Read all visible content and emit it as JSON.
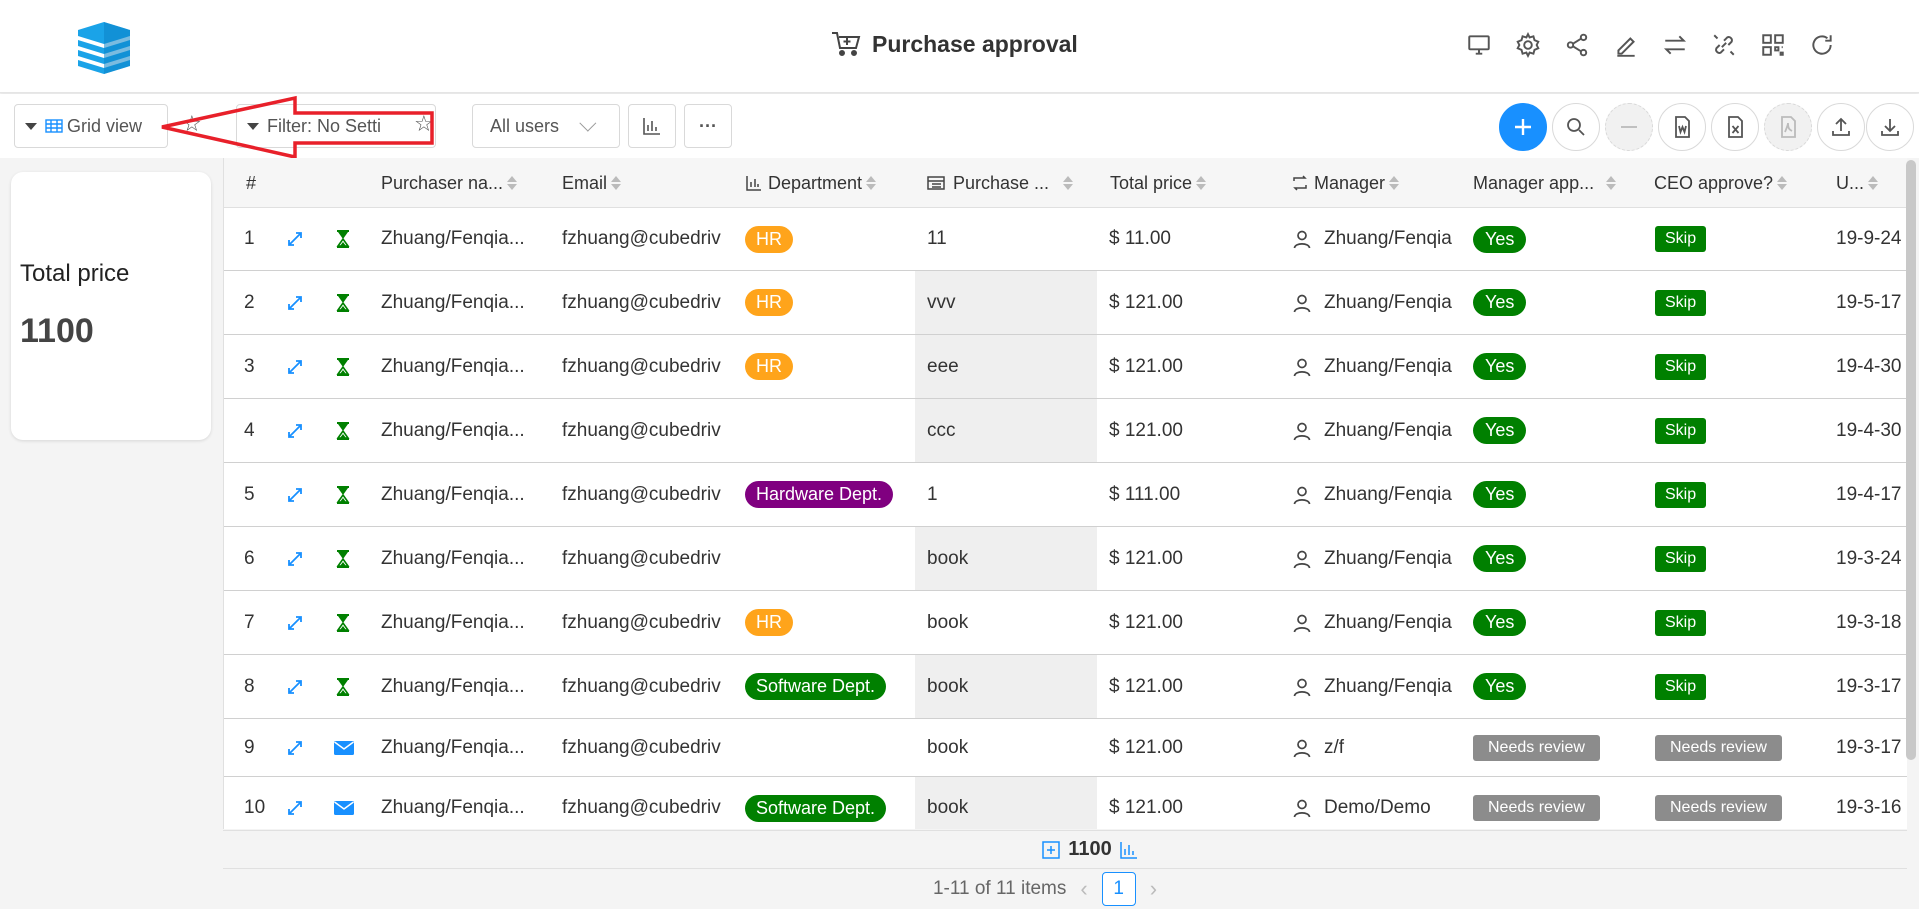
{
  "header": {
    "title": "Purchase approval",
    "icons": [
      "desktop-icon",
      "gear-icon",
      "share-icon",
      "edit-icon",
      "switch-icon",
      "link-icon",
      "qrcode-icon",
      "refresh-icon"
    ]
  },
  "toolbar": {
    "view_label": "Grid view",
    "filter_label": "Filter: No Setti",
    "users_select": "All users",
    "more_label": "···"
  },
  "summary_card": {
    "label": "Total price",
    "value": "1100"
  },
  "grid": {
    "columns": [
      {
        "key": "num",
        "label": "#"
      },
      {
        "key": "purchaser",
        "label": "Purchaser na..."
      },
      {
        "key": "email",
        "label": "Email"
      },
      {
        "key": "department",
        "label": "Department"
      },
      {
        "key": "purchase",
        "label": "Purchase ..."
      },
      {
        "key": "total",
        "label": "Total price"
      },
      {
        "key": "manager",
        "label": "Manager"
      },
      {
        "key": "manager_approve",
        "label": "Manager app..."
      },
      {
        "key": "ceo_approve",
        "label": "CEO approve?"
      },
      {
        "key": "updated",
        "label": "U..."
      }
    ],
    "rows": [
      {
        "num": "1",
        "status": "hourglass",
        "purchaser": "Zhuang/Fenqia...",
        "email": "fzhuang@cubedriv",
        "department": "HR",
        "dept_color": "orange",
        "purchase": "11",
        "total": "$ 11.00",
        "manager": "Zhuang/Fenqia",
        "manager_approve": "Yes",
        "ceo_approve": "Skip",
        "updated": "19-9-24"
      },
      {
        "num": "2",
        "status": "hourglass",
        "purchaser": "Zhuang/Fenqia...",
        "email": "fzhuang@cubedriv",
        "department": "HR",
        "dept_color": "orange",
        "purchase": "vvv",
        "total": "$ 121.00",
        "manager": "Zhuang/Fenqia",
        "manager_approve": "Yes",
        "ceo_approve": "Skip",
        "updated": "19-5-17"
      },
      {
        "num": "3",
        "status": "hourglass",
        "purchaser": "Zhuang/Fenqia...",
        "email": "fzhuang@cubedriv",
        "department": "HR",
        "dept_color": "orange",
        "purchase": "eee",
        "total": "$ 121.00",
        "manager": "Zhuang/Fenqia",
        "manager_approve": "Yes",
        "ceo_approve": "Skip",
        "updated": "19-4-30"
      },
      {
        "num": "4",
        "status": "hourglass",
        "purchaser": "Zhuang/Fenqia...",
        "email": "fzhuang@cubedriv",
        "department": "",
        "dept_color": "",
        "purchase": "ccc",
        "total": "$ 121.00",
        "manager": "Zhuang/Fenqia",
        "manager_approve": "Yes",
        "ceo_approve": "Skip",
        "updated": "19-4-30"
      },
      {
        "num": "5",
        "status": "hourglass",
        "purchaser": "Zhuang/Fenqia...",
        "email": "fzhuang@cubedriv",
        "department": "Hardware Dept.",
        "dept_color": "purple",
        "purchase": "1",
        "total": "$ 111.00",
        "manager": "Zhuang/Fenqia",
        "manager_approve": "Yes",
        "ceo_approve": "Skip",
        "updated": "19-4-17"
      },
      {
        "num": "6",
        "status": "hourglass",
        "purchaser": "Zhuang/Fenqia...",
        "email": "fzhuang@cubedriv",
        "department": "",
        "dept_color": "",
        "purchase": "book",
        "total": "$ 121.00",
        "manager": "Zhuang/Fenqia",
        "manager_approve": "Yes",
        "ceo_approve": "Skip",
        "updated": "19-3-24"
      },
      {
        "num": "7",
        "status": "hourglass",
        "purchaser": "Zhuang/Fenqia...",
        "email": "fzhuang@cubedriv",
        "department": "HR",
        "dept_color": "orange",
        "purchase": "book",
        "total": "$ 121.00",
        "manager": "Zhuang/Fenqia",
        "manager_approve": "Yes",
        "ceo_approve": "Skip",
        "updated": "19-3-18"
      },
      {
        "num": "8",
        "status": "hourglass",
        "purchaser": "Zhuang/Fenqia...",
        "email": "fzhuang@cubedriv",
        "department": "Software Dept.",
        "dept_color": "green",
        "purchase": "book",
        "total": "$ 121.00",
        "manager": "Zhuang/Fenqia",
        "manager_approve": "Yes",
        "ceo_approve": "Skip",
        "updated": "19-3-17"
      },
      {
        "num": "9",
        "status": "mail",
        "purchaser": "Zhuang/Fenqia...",
        "email": "fzhuang@cubedriv",
        "department": "",
        "dept_color": "",
        "purchase": "book",
        "total": "$ 121.00",
        "manager": "z/f",
        "manager_approve": "Needs review",
        "ceo_approve": "Needs review",
        "updated": "19-3-17"
      },
      {
        "num": "10",
        "status": "mail",
        "purchaser": "Zhuang/Fenqia...",
        "email": "fzhuang@cubedriv",
        "department": "Software Dept.",
        "dept_color": "green",
        "purchase": "book",
        "total": "$ 121.00",
        "manager": "Demo/Demo",
        "manager_approve": "Needs review",
        "ceo_approve": "Needs review",
        "updated": "19-3-16"
      }
    ]
  },
  "footer": {
    "summary_total": "1100",
    "items_text": "1-11 of 11 items",
    "current_page": "1"
  },
  "colors": {
    "primary": "#1890ff",
    "green": "#008000",
    "orange": "#ffa41b",
    "purple": "#800080",
    "gray_badge": "#8c8c8c",
    "annotation_red": "#e8202a"
  }
}
